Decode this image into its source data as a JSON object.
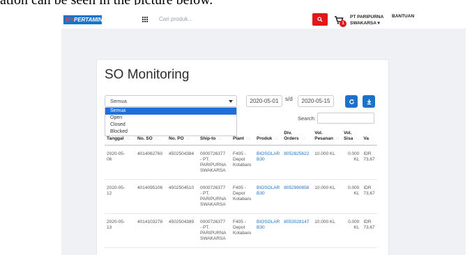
{
  "caption": "ation can be seen in the picture below.",
  "header": {
    "logo": "MYPERTAMINA",
    "search_placeholder": "Cari produk...",
    "cart_count": "1",
    "user_line1": "PT PARIPURNA",
    "user_line2": "SWAKARSA ▾",
    "help_label": "BANTUAN"
  },
  "page": {
    "title": "SO Monitoring"
  },
  "filter": {
    "selected": "Semua",
    "options": [
      "Semua",
      "Open",
      "Closed",
      "Blocked"
    ],
    "date_from": "2020-05-01",
    "separator": "s/d",
    "date_to": "2020-05-15",
    "refresh_icon": "refresh-icon",
    "download_icon": "download-icon",
    "search_label": "Search:"
  },
  "table": {
    "columns": [
      "Tanggal",
      "No. SO",
      "No. PO",
      "Ship-to",
      "Plant",
      "Produk",
      "Div. Orders",
      "Vol. Pesanan",
      "Vol. Sisa",
      "Va"
    ],
    "rows": [
      [
        "2020-05-\n06",
        "4014062760",
        "4502504384",
        "0000726377\n- PT.\nPARIPURNA\nSWAKARSA",
        "F405 -\nDepot\nKotabaru",
        "BIOSOLAR\nB30",
        "8052825622",
        "10.000 KL",
        "0.000\nKL",
        "IDR\n73,67"
      ],
      [
        "2020-05-\n12",
        "4014095106",
        "4502504510",
        "0000726377\n- PT.\nPARIPURNA\nSWAKARSA",
        "F405 -\nDepot\nKotabaru",
        "BIOSOLAR\nB30",
        "8052990858",
        "10.000 KL",
        "0.000\nKL",
        "IDR\n73,67"
      ],
      [
        "2020-05-\n13",
        "4014103278",
        "4502504389",
        "0000726377\n- PT.\nPARIPURNA\nSWAKARSA",
        "F405 -\nDepot\nKotabaru",
        "BIOSOLAR\nB30",
        "8053028147",
        "10.000 KL",
        "0.000\nKL",
        "IDR\n73,67"
      ]
    ]
  },
  "colors": {
    "accent": "#1a73c8",
    "danger": "#e2171b",
    "background": "#f0f1f5"
  }
}
